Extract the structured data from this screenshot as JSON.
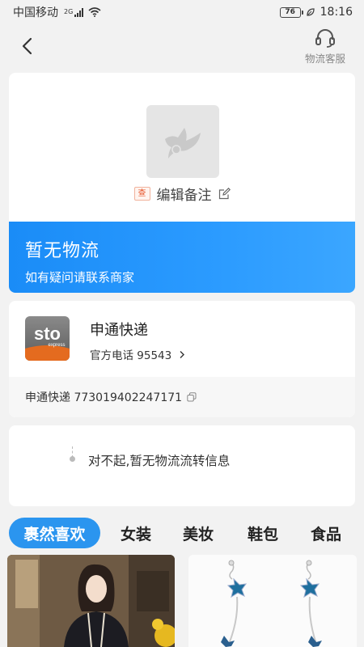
{
  "status_bar": {
    "carrier": "中国移动",
    "network": "2G",
    "battery": "76",
    "time": "18:16"
  },
  "nav": {
    "back_icon": "chevron-left-icon",
    "service_icon": "headset-icon",
    "service_label": "物流客服"
  },
  "product": {
    "image_icon": "bird-placeholder-icon",
    "remark_tag": "查",
    "remark_label": "编辑备注",
    "edit_icon": "edit-icon"
  },
  "status": {
    "title": "暂无物流",
    "subtitle": "如有疑问请联系商家",
    "color": "#1a8cf7"
  },
  "courier": {
    "logo_text": "sto",
    "logo_sub": "express",
    "name": "申通快递",
    "phone_label": "官方电话 95543",
    "tracking": "申通快递 773019402247171",
    "copy_icon": "copy-icon"
  },
  "trace": {
    "message": "对不起,暂无物流流转信息"
  },
  "tabs": [
    {
      "label": "裹然喜欢",
      "active": true
    },
    {
      "label": "女装",
      "active": false
    },
    {
      "label": "美妆",
      "active": false
    },
    {
      "label": "鞋包",
      "active": false
    },
    {
      "label": "食品",
      "active": false
    }
  ],
  "accent_color": "#2b95ef"
}
